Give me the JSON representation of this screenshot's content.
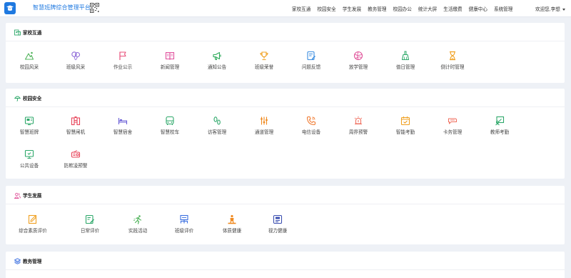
{
  "header": {
    "app_title": "智慧班牌综合管理平台",
    "nav": [
      {
        "label": "家校互通"
      },
      {
        "label": "校园安全"
      },
      {
        "label": "学生发展"
      },
      {
        "label": "教务管理"
      },
      {
        "label": "校园办公"
      },
      {
        "label": "统计大屏"
      },
      {
        "label": "生活缴费"
      },
      {
        "label": "健康中心"
      },
      {
        "label": "系统管理"
      }
    ],
    "user_greeting": "欢迎您,李想"
  },
  "sections": [
    {
      "title": "家校互通",
      "icon": "home-school-icon",
      "items": [
        {
          "label": "校园风采",
          "icon": "campus-style-icon",
          "color": "#52b45c"
        },
        {
          "label": "班级风采",
          "icon": "balloons-icon",
          "color": "#8f6bd8"
        },
        {
          "label": "作业公示",
          "icon": "flag-icon",
          "color": "#e8507a"
        },
        {
          "label": "新闻管理",
          "icon": "book-icon",
          "color": "#e04e9c"
        },
        {
          "label": "通知公告",
          "icon": "megaphone-icon",
          "color": "#2eaa5b"
        },
        {
          "label": "班级荣誉",
          "icon": "trophy-icon",
          "color": "#f0a020"
        },
        {
          "label": "问题反馈",
          "icon": "feedback-icon",
          "color": "#3b8de0"
        },
        {
          "label": "放学管理",
          "icon": "ball-icon",
          "color": "#e0539a"
        },
        {
          "label": "值日管理",
          "icon": "broom-icon",
          "color": "#2ea86a"
        },
        {
          "label": "倒计时管理",
          "icon": "hourglass-icon",
          "color": "#f0a020"
        }
      ]
    },
    {
      "title": "校园安全",
      "icon": "umbrella-icon",
      "items": [
        {
          "label": "智慧班牌",
          "icon": "class-board-icon",
          "color": "#2ea86a"
        },
        {
          "label": "智慧闸机",
          "icon": "gate-icon",
          "color": "#e8445a"
        },
        {
          "label": "智慧宿舍",
          "icon": "bed-icon",
          "color": "#6a5fd6"
        },
        {
          "label": "智慧校车",
          "icon": "bus-icon",
          "color": "#2ea86a"
        },
        {
          "label": "访客管理",
          "icon": "footprint-icon",
          "color": "#2ea86a"
        },
        {
          "label": "通道管理",
          "icon": "channel-icon",
          "color": "#f08a20"
        },
        {
          "label": "电信设备",
          "icon": "phone-icon",
          "color": "#f07a30"
        },
        {
          "label": "周界预警",
          "icon": "alarm-icon",
          "color": "#f07060"
        },
        {
          "label": "智能考勤",
          "icon": "calendar-check-icon",
          "color": "#f0a020"
        },
        {
          "label": "卡务管理",
          "icon": "card-icon",
          "color": "#f07060"
        },
        {
          "label": "教师考勤",
          "icon": "teacher-icon",
          "color": "#2ea86a"
        },
        {
          "label": "公共设备",
          "icon": "monitor-icon",
          "color": "#2ea86a"
        },
        {
          "label": "防欺凌预警",
          "icon": "radio-icon",
          "color": "#e8445a"
        }
      ]
    },
    {
      "title": "学生发展",
      "icon": "people-icon",
      "items": [
        {
          "label": "综合素质评价",
          "icon": "edit-paper-icon",
          "color": "#f0a020"
        },
        {
          "label": "日常评价",
          "icon": "edit-note-icon",
          "color": "#2ea86a"
        },
        {
          "label": "实践活动",
          "icon": "running-icon",
          "color": "#52b45c"
        },
        {
          "label": "班级评价",
          "icon": "class-eval-icon",
          "color": "#3b6fe0"
        },
        {
          "label": "体质健康",
          "icon": "fitness-icon",
          "color": "#f08a20"
        },
        {
          "label": "视力健康",
          "icon": "vision-icon",
          "color": "#3b4fb0"
        }
      ]
    },
    {
      "title": "教务管理",
      "icon": "layers-icon",
      "items": []
    }
  ]
}
